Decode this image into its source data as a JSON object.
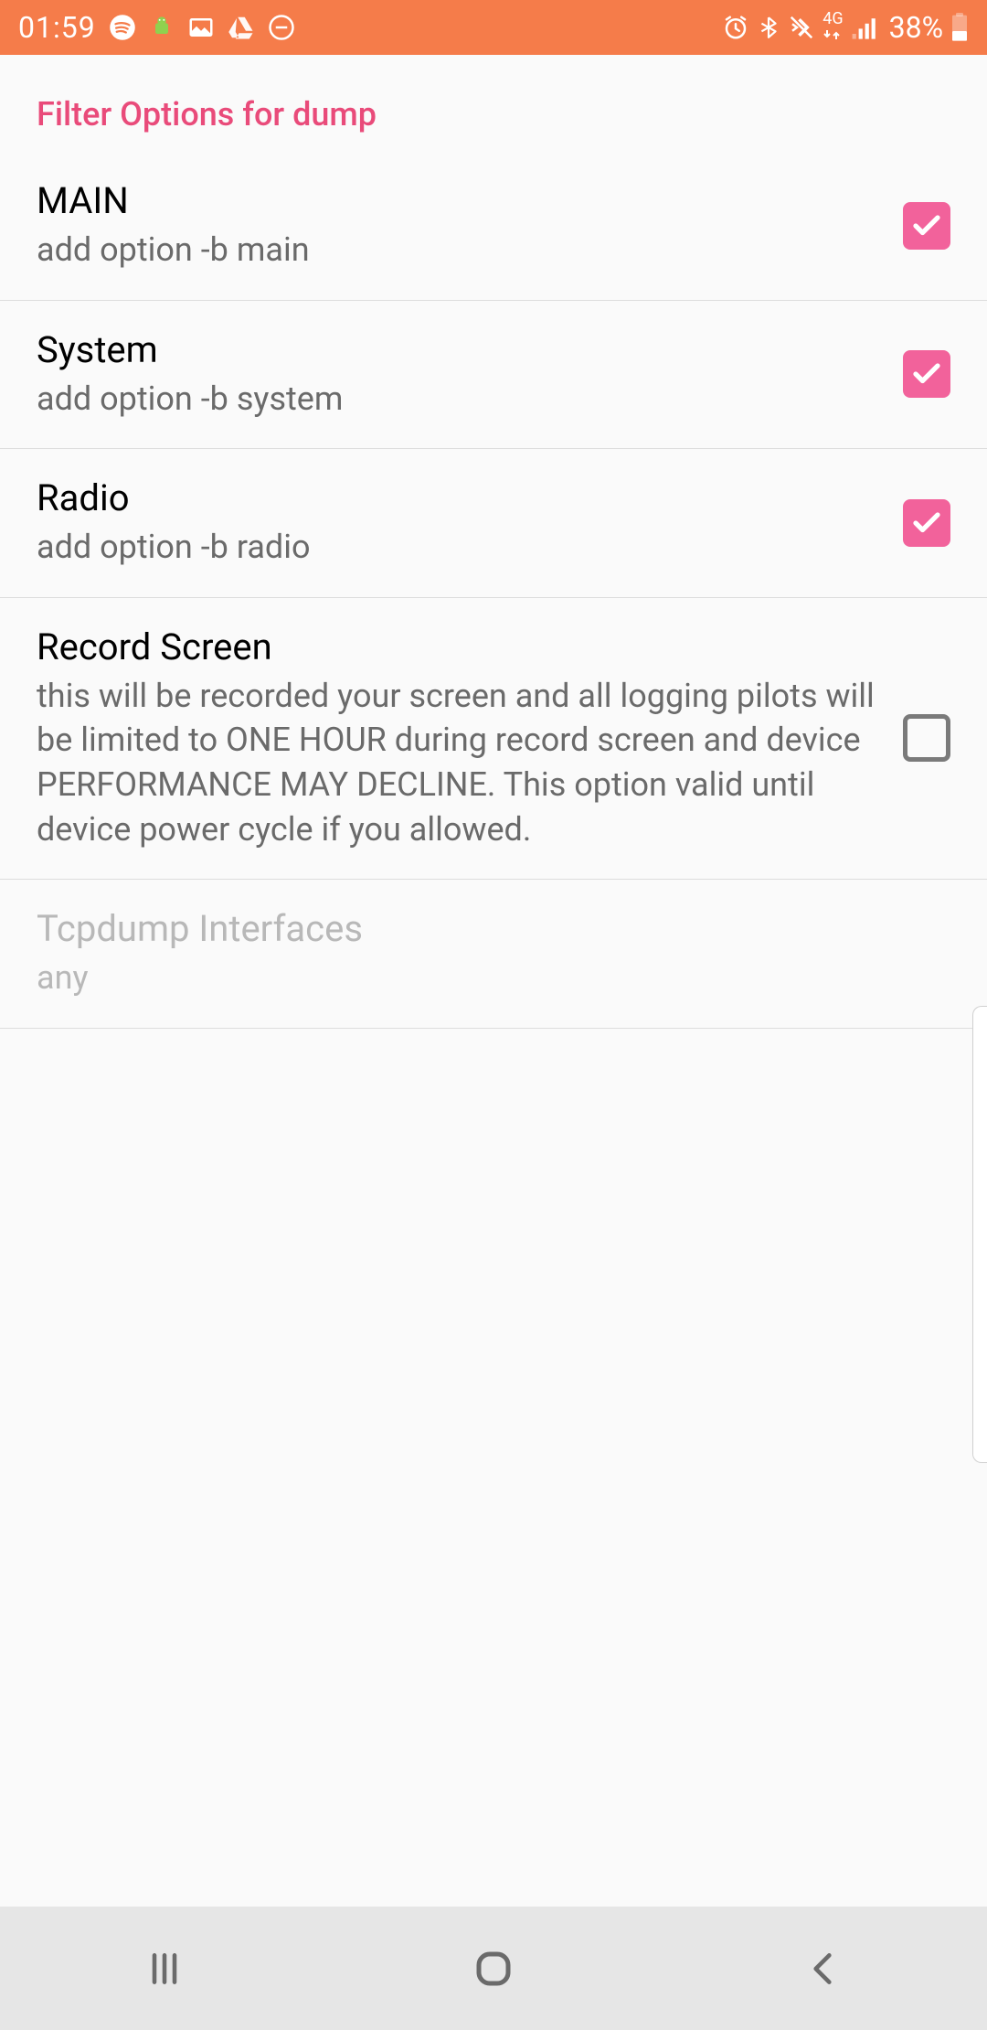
{
  "status": {
    "time": "01:59",
    "battery": "38%"
  },
  "header": "Filter Options for dump",
  "rows": [
    {
      "title": "MAIN",
      "subtitle": "add option -b main",
      "checked": true,
      "enabled": true,
      "hasCheckbox": true
    },
    {
      "title": "System",
      "subtitle": "add option -b system",
      "checked": true,
      "enabled": true,
      "hasCheckbox": true
    },
    {
      "title": "Radio",
      "subtitle": "add option -b radio",
      "checked": true,
      "enabled": true,
      "hasCheckbox": true
    },
    {
      "title": "Record Screen",
      "subtitle": "this will be recorded your screen and all logging pilots will be limited to ONE HOUR during record screen and device PERFORMANCE MAY DECLINE. This option valid until device power cycle if you allowed.",
      "checked": false,
      "enabled": true,
      "hasCheckbox": true
    },
    {
      "title": "Tcpdump Interfaces",
      "subtitle": "any",
      "checked": false,
      "enabled": false,
      "hasCheckbox": false
    }
  ]
}
